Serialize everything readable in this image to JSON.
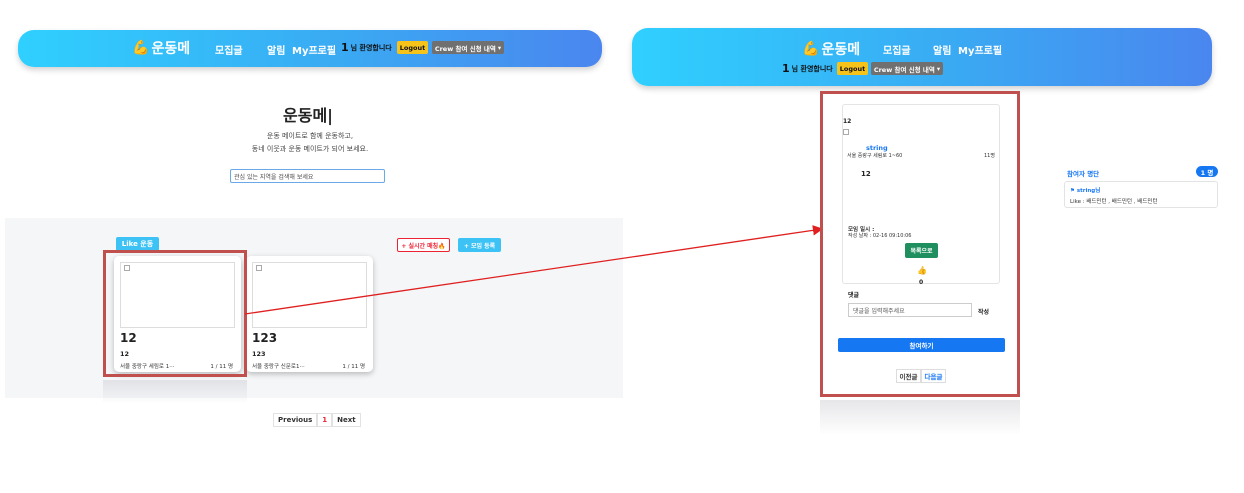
{
  "nav": {
    "logo_text": "운동메",
    "links": [
      "모집글",
      "알림",
      "My프로필"
    ],
    "user_number": "1",
    "user_greeting": "님 환영합니다",
    "logout_label": "Logout",
    "crew_label": "Crew 참여 신청 내역",
    "crew_caret": "▾"
  },
  "hero": {
    "title": "운동메|",
    "subtitle_line1": "운동 메이트로 함께 운동하고,",
    "subtitle_line2": "동네 이웃과 운동 메이트가 되어 보세요.",
    "search_placeholder": "관심 있는 지역을 검색해 보세요"
  },
  "list": {
    "like_label": "Like 운동",
    "realtime_label": "+ 실시간 매칭🔥",
    "add_label": "+ 모임 등록",
    "cards": [
      {
        "title": "12",
        "subtitle": "12",
        "address": "서울 중랑구 세림로 1···",
        "count": "1 / 11 명"
      },
      {
        "title": "123",
        "subtitle": "123",
        "address": "서울 중랑구 신문로1···",
        "count": "1 / 11 명"
      }
    ]
  },
  "pagination": {
    "prev": "Previous",
    "current": "1",
    "next": "Next"
  },
  "detail": {
    "id_label": "12",
    "author": "string",
    "address": "서울 중랑구 세림로 1~60",
    "count": "11명",
    "title": "12",
    "meeting_label": "모임 일시 :",
    "created_label": "작성 날짜 : 02-16 09:10:06",
    "status_label": "목록으로",
    "like_icon": "👍",
    "like_count": "0",
    "comment_header": "댓글",
    "comment_placeholder": "댓글을 입력해주세요",
    "comment_submit": "작성",
    "join_label": "참여하기",
    "prev_label": "이전글",
    "next_label": "다음글"
  },
  "participants": {
    "title": "참여자 명단",
    "badge": "1 명",
    "name": "⚑ string님",
    "like_line": "Like : 배드민턴 , 배드민턴 , 배드민턴"
  },
  "colors": {
    "nav_gradient_start": "#2fd0ff",
    "nav_gradient_end": "#4a86ef",
    "logout_bg": "#f6c31a",
    "highlight": "#c0504d",
    "accent_blue": "#1677f2",
    "arrow": "#e02020"
  }
}
